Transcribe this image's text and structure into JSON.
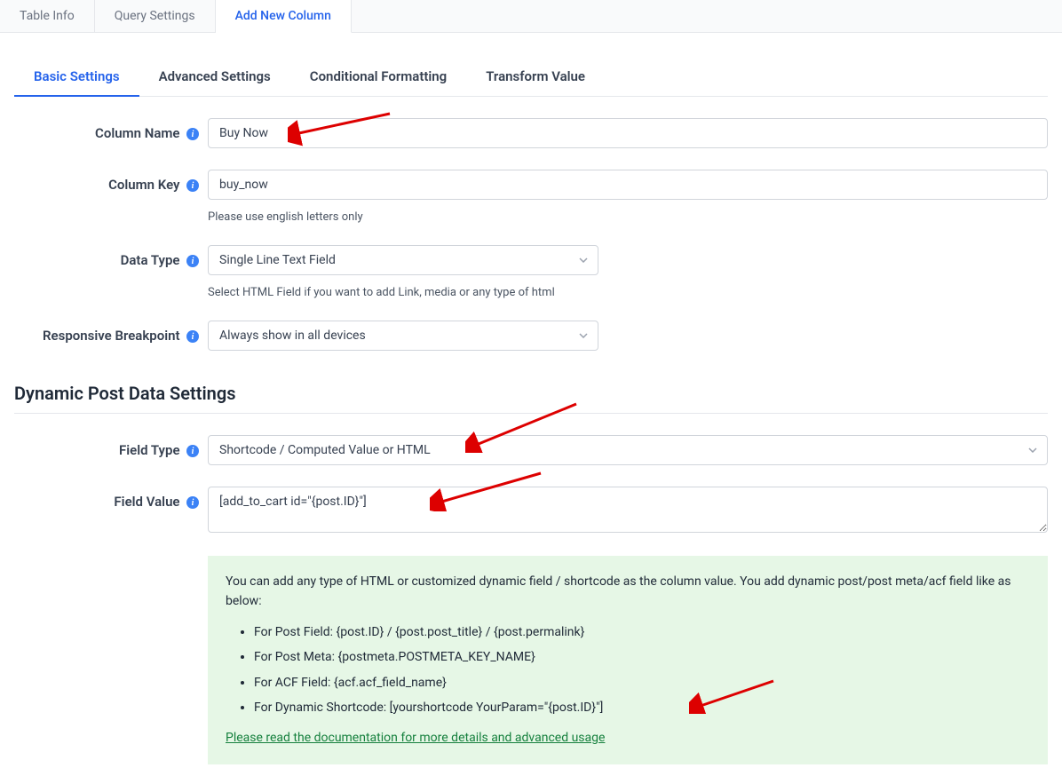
{
  "topTabs": {
    "tableInfo": "Table Info",
    "querySettings": "Query Settings",
    "addNewColumn": "Add New Column"
  },
  "subTabs": {
    "basic": "Basic Settings",
    "advanced": "Advanced Settings",
    "conditional": "Conditional Formatting",
    "transform": "Transform Value"
  },
  "labels": {
    "columnName": "Column Name",
    "columnKey": "Column Key",
    "dataType": "Data Type",
    "responsive": "Responsive Breakpoint",
    "fieldType": "Field Type",
    "fieldValue": "Field Value"
  },
  "values": {
    "columnName": "Buy Now",
    "columnKey": "buy_now",
    "dataType": "Single Line Text Field",
    "responsive": "Always show in all devices",
    "fieldType": "Shortcode / Computed Value or HTML",
    "fieldValue": "[add_to_cart id=\"{post.ID}\"]"
  },
  "helpers": {
    "columnKey": "Please use english letters only",
    "dataType": "Select HTML Field if you want to add Link, media or any type of html"
  },
  "sectionTitle": "Dynamic Post Data Settings",
  "infoBox": {
    "intro": "You can add any type of HTML or customized dynamic field / shortcode as the column value. You add dynamic post/post meta/acf field like as below:",
    "items": [
      "For Post Field: {post.ID} / {post.post_title} / {post.permalink}",
      "For Post Meta: {postmeta.POSTMETA_KEY_NAME}",
      "For ACF Field: {acf.acf_field_name}",
      "For Dynamic Shortcode: [yourshortcode YourParam=\"{post.ID}\"]"
    ],
    "link": "Please read the documentation for more details and advanced usage"
  }
}
